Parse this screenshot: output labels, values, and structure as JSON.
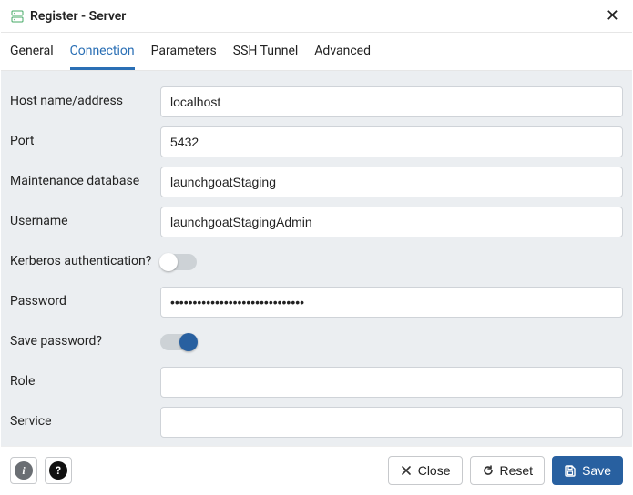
{
  "titlebar": {
    "title": "Register - Server"
  },
  "tabs": {
    "general": "General",
    "connection": "Connection",
    "parameters": "Parameters",
    "ssh_tunnel": "SSH Tunnel",
    "advanced": "Advanced"
  },
  "form": {
    "host_label": "Host name/address",
    "host_value": "localhost",
    "port_label": "Port",
    "port_value": "5432",
    "maintdb_label": "Maintenance database",
    "maintdb_value": "launchgoatStaging",
    "username_label": "Username",
    "username_value": "launchgoatStagingAdmin",
    "kerberos_label": "Kerberos authentication?",
    "kerberos_on": false,
    "password_label": "Password",
    "password_value": "••••••••••••••••••••••••••••••",
    "savepw_label": "Save password?",
    "savepw_on": true,
    "role_label": "Role",
    "role_value": "",
    "service_label": "Service",
    "service_value": ""
  },
  "footer": {
    "close": "Close",
    "reset": "Reset",
    "save": "Save"
  }
}
